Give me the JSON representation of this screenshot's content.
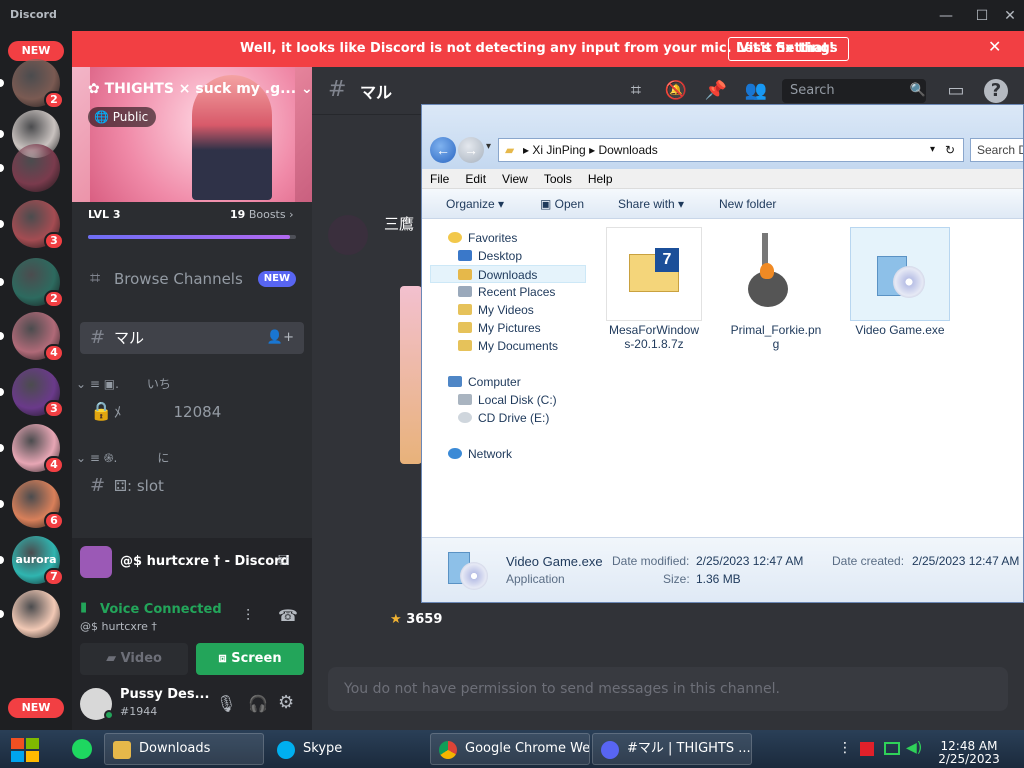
{
  "app": {
    "brand": "Discord"
  },
  "window_controls": {
    "minimize": "—",
    "maximize": "☐",
    "close": "✕"
  },
  "rail": {
    "new_label": "NEW",
    "servers": [
      {
        "badge": "2",
        "color": "#7a5a52"
      },
      {
        "badge": "",
        "color": "#c9c2bf"
      },
      {
        "badge": "",
        "color": "#7a3b4d"
      },
      {
        "badge": "3",
        "color": "#a44c52"
      },
      {
        "badge": "2",
        "color": "#2d6a5f"
      },
      {
        "badge": "4",
        "color": "#b06a78"
      },
      {
        "badge": "3",
        "color": "#6a3a8a"
      },
      {
        "badge": "4",
        "color": "#e7a6b4"
      },
      {
        "badge": "6",
        "color": "#d9805a"
      },
      {
        "badge": "7",
        "color": "#2fb5b0",
        "label": "aurora"
      },
      {
        "badge": "",
        "color": "#f2c9b5"
      }
    ]
  },
  "mic_banner": {
    "message": "Well, it looks like Discord is not detecting any input from your mic. Let's fix that!",
    "button": "Visit Settings",
    "close": "✕"
  },
  "server": {
    "name": "THIGHTS × suck my .g...",
    "visibility": "Public",
    "level": "LVL 3",
    "boosts_count": "19",
    "boosts_label": "Boosts",
    "boost_progress": 0.97
  },
  "channels": {
    "browse": "Browse Channels",
    "browse_badge": "NEW",
    "current": "マル",
    "cat1": "≡ ▣.",
    "cat1_name": "いち",
    "locked_channel_prefix": "ﾒ",
    "locked_channel_value": "12084",
    "cat2": "≡ ֍.",
    "cat2_name": "に",
    "slot_channel": "slot"
  },
  "voice": {
    "title": "@$ hurtcxre † - Discord",
    "status": "Voice Connected",
    "sub": "@$ hurtcxre †",
    "video": "Video",
    "screen": "Screen"
  },
  "user": {
    "name": "Pussy Des...",
    "tag": "#1944"
  },
  "main": {
    "channel": "マル",
    "search_placeholder": "Search",
    "message_author": "三鷹",
    "reaction_count": "3659",
    "composer": "You do not have permission to send messages in this channel."
  },
  "explorer": {
    "breadcrumb_1": "Xi JinPing",
    "breadcrumb_2": "Downloads",
    "search": "Search D",
    "menu": [
      "File",
      "Edit",
      "View",
      "Tools",
      "Help"
    ],
    "commands": {
      "organize": "Organize",
      "open": "Open",
      "share": "Share with",
      "newfolder": "New folder"
    },
    "nav": {
      "favorites": "Favorites",
      "desktop": "Desktop",
      "downloads": "Downloads",
      "recent": "Recent Places",
      "videos": "My Videos",
      "pictures": "My Pictures",
      "documents": "My Documents",
      "computer": "Computer",
      "localdisk": "Local Disk (C:)",
      "cddrive": "CD Drive (E:)",
      "network": "Network"
    },
    "files": [
      {
        "name": "MesaForWindows-20.1.8.7z"
      },
      {
        "name": "Primal_Forkie.png"
      },
      {
        "name": "Video Game.exe"
      }
    ],
    "details": {
      "name": "Video Game.exe",
      "type": "Application",
      "modified_label": "Date modified:",
      "modified": "2/25/2023 12:47 AM",
      "size_label": "Size:",
      "size": "1.36 MB",
      "created_label": "Date created:",
      "created": "2/25/2023 12:47 AM"
    }
  },
  "taskbar": {
    "items": [
      {
        "label": "Downloads"
      },
      {
        "label": "Skype"
      },
      {
        "label": "Google Chrome We..."
      },
      {
        "label": "#マル | THIGHTS ..."
      }
    ],
    "time": "12:48 AM",
    "date": "2/25/2023"
  }
}
